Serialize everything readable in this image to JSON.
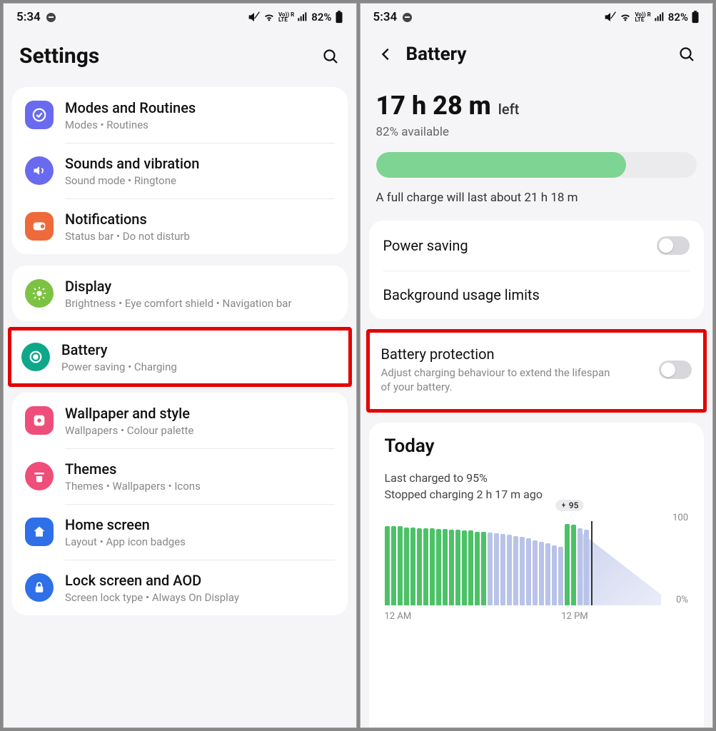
{
  "status": {
    "time": "5:34",
    "battery_pct": "82%"
  },
  "left": {
    "title": "Settings",
    "groups": [
      {
        "items": [
          {
            "title": "Modes and Routines",
            "sub": "Modes  •  Routines",
            "icon": "modes",
            "color": "#6a6af0"
          },
          {
            "title": "Sounds and vibration",
            "sub": "Sound mode  •  Ringtone",
            "icon": "sound",
            "color": "#6a6af0"
          },
          {
            "title": "Notifications",
            "sub": "Status bar  •  Do not disturb",
            "icon": "notif",
            "color": "#ee6a3a"
          }
        ]
      },
      {
        "items": [
          {
            "title": "Display",
            "sub": "Brightness  •  Eye comfort shield  •  Navigation bar",
            "icon": "display",
            "color": "#7cc243"
          },
          {
            "title": "Battery",
            "sub": "Power saving  •  Charging",
            "icon": "battery",
            "color": "#0ea789",
            "highlight": true
          }
        ]
      },
      {
        "items": [
          {
            "title": "Wallpaper and style",
            "sub": "Wallpapers  •  Colour palette",
            "icon": "wallpaper",
            "color": "#ef4d7a"
          },
          {
            "title": "Themes",
            "sub": "Themes  •  Wallpapers  •  Icons",
            "icon": "themes",
            "color": "#ef4d7a"
          },
          {
            "title": "Home screen",
            "sub": "Layout  •  App icon badges",
            "icon": "home",
            "color": "#2f6fe8"
          },
          {
            "title": "Lock screen and AOD",
            "sub": "Screen lock type  •  Always On Display",
            "icon": "lock",
            "color": "#2f6fe8"
          }
        ]
      }
    ]
  },
  "right": {
    "title": "Battery",
    "time_left": "17 h 28 m",
    "time_left_suffix": "left",
    "available": "82% available",
    "bar_percent": 78,
    "full_charge_estimate": "A full charge will last about 21 h 18 m",
    "rows": [
      {
        "title": "Power saving",
        "toggle": false
      },
      {
        "title": "Background usage limits"
      }
    ],
    "protection": {
      "title": "Battery protection",
      "sub": "Adjust charging behaviour to extend the lifespan of your battery.",
      "toggle": false
    },
    "today": {
      "title": "Today",
      "line1": "Last charged to 95%",
      "line2": "Stopped charging 2 h 17 m ago",
      "badge": "95",
      "x0": "12 AM",
      "x1": "12 PM",
      "y_top": "100",
      "y_bot": "0%"
    }
  },
  "chart_data": {
    "type": "bar",
    "title": "Today battery level",
    "xlabel": "Time",
    "ylabel": "Battery %",
    "ylim": [
      0,
      100
    ],
    "x_ticks": [
      "12 AM",
      "12 PM"
    ],
    "annotations": [
      {
        "label": "⚡95",
        "x_index": 28
      }
    ],
    "series": [
      {
        "name": "Charging",
        "color": "#4cc267",
        "values": [
          92,
          92,
          92,
          91,
          91,
          90,
          90,
          90,
          89,
          89,
          88,
          88,
          87,
          87,
          86,
          86,
          null,
          null,
          null,
          null,
          null,
          null,
          null,
          null,
          null,
          null,
          null,
          null,
          95,
          94,
          null,
          null,
          null,
          null,
          null,
          null,
          null,
          null,
          null,
          null,
          null,
          null
        ]
      },
      {
        "name": "Discharging",
        "color": "#b9c3e8",
        "values": [
          null,
          null,
          null,
          null,
          null,
          null,
          null,
          null,
          null,
          null,
          null,
          null,
          null,
          null,
          null,
          null,
          85,
          84,
          83,
          82,
          81,
          80,
          78,
          76,
          74,
          72,
          70,
          68,
          null,
          null,
          90,
          88,
          null,
          null,
          null,
          null,
          null,
          null,
          null,
          null,
          null,
          null
        ]
      },
      {
        "name": "Projected",
        "color": "#b9c3e8",
        "style": "area",
        "values": [
          null,
          null,
          null,
          null,
          null,
          null,
          null,
          null,
          null,
          null,
          null,
          null,
          null,
          null,
          null,
          null,
          null,
          null,
          null,
          null,
          null,
          null,
          null,
          null,
          null,
          null,
          null,
          null,
          null,
          null,
          null,
          null,
          86,
          80,
          74,
          68,
          62,
          56,
          50,
          44,
          38,
          32
        ]
      }
    ]
  }
}
